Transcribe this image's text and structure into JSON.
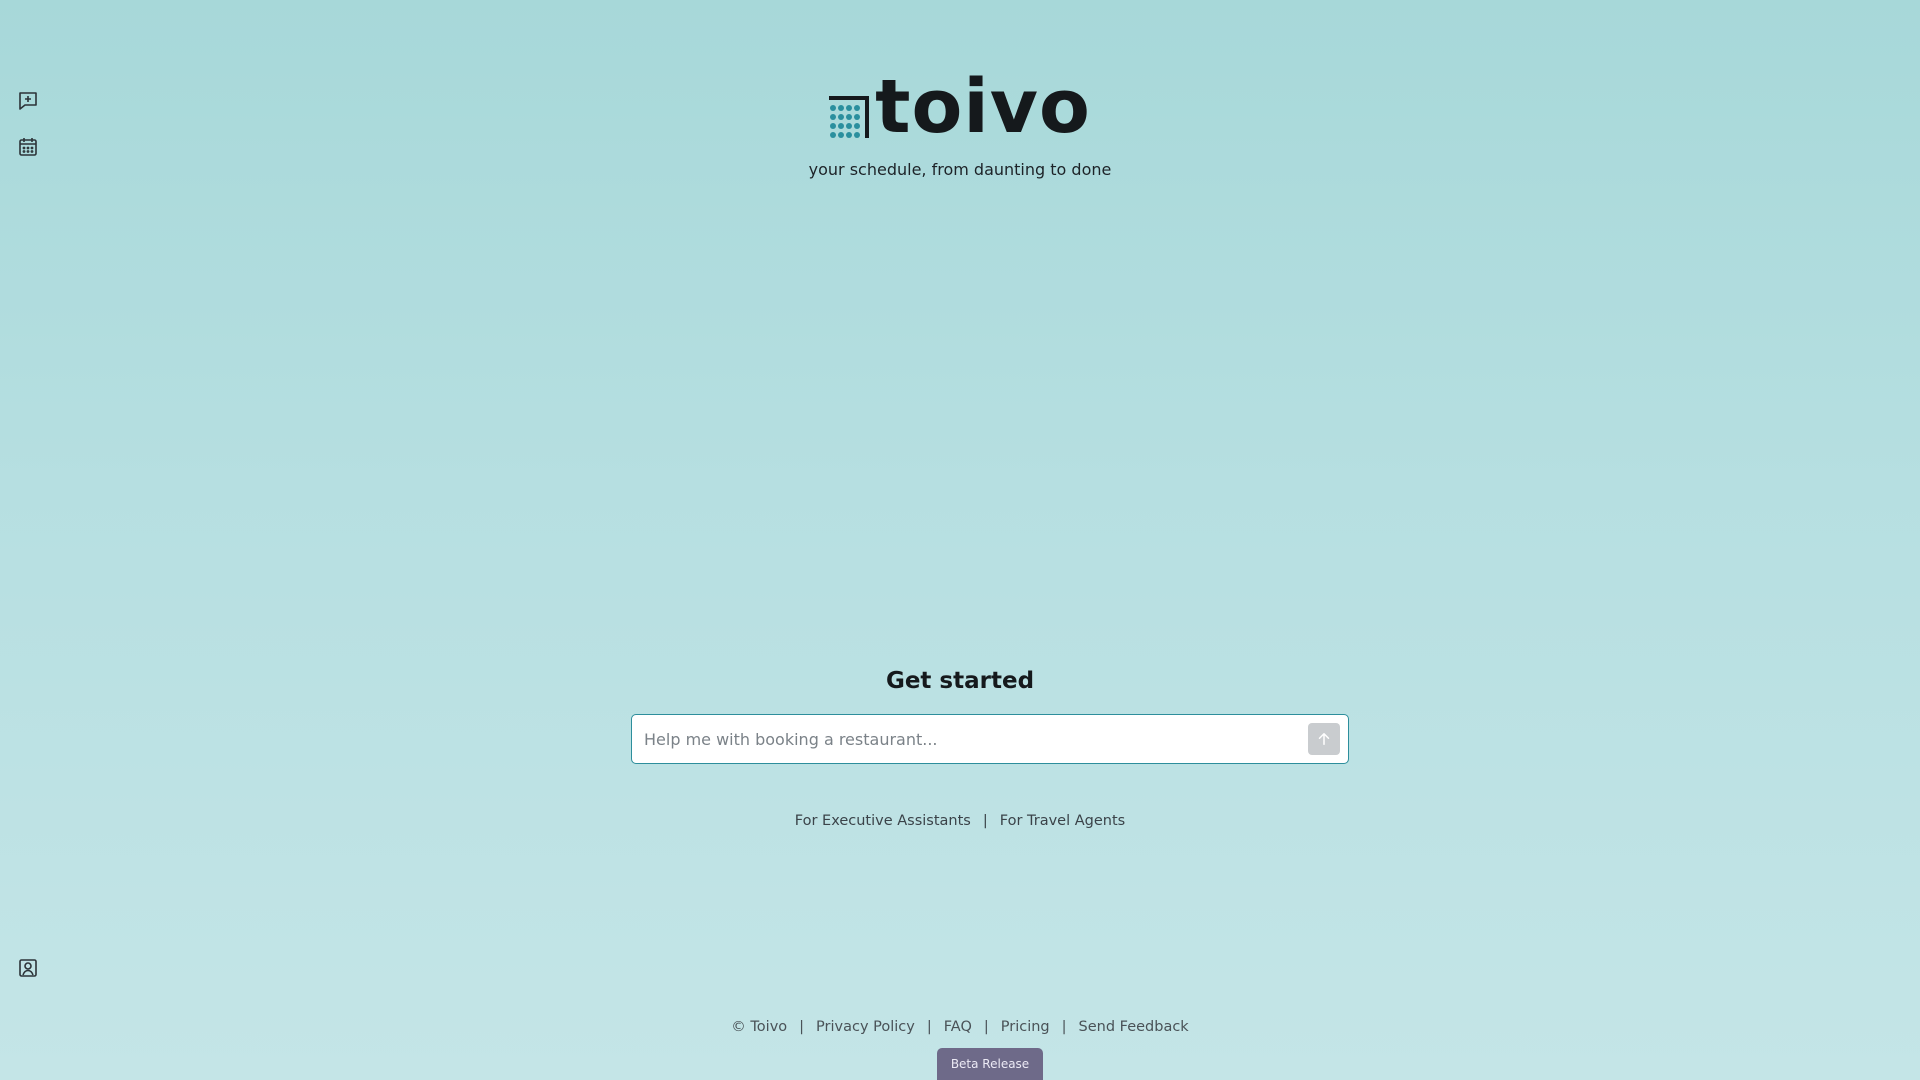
{
  "brand": {
    "name": "toivo",
    "tagline": "your schedule, from daunting to done",
    "logo_color": "#2a8f9e"
  },
  "rail": {
    "new_chat_icon": "new-chat-icon",
    "calendar_icon": "calendar-icon",
    "profile_icon": "profile-icon"
  },
  "main": {
    "heading": "Get started",
    "input_placeholder": "Help me with booking a restaurant...",
    "send_icon": "arrow-up-icon"
  },
  "audience_links": [
    "For Executive Assistants",
    "For Travel Agents"
  ],
  "footer": {
    "copyright": "© Toivo",
    "links": [
      "Privacy Policy",
      "FAQ",
      "Pricing",
      "Send Feedback"
    ],
    "separator": "|"
  },
  "beta_badge": "Beta Release",
  "colors": {
    "accent": "#2d8e9c",
    "badge": "#6e6a89"
  }
}
